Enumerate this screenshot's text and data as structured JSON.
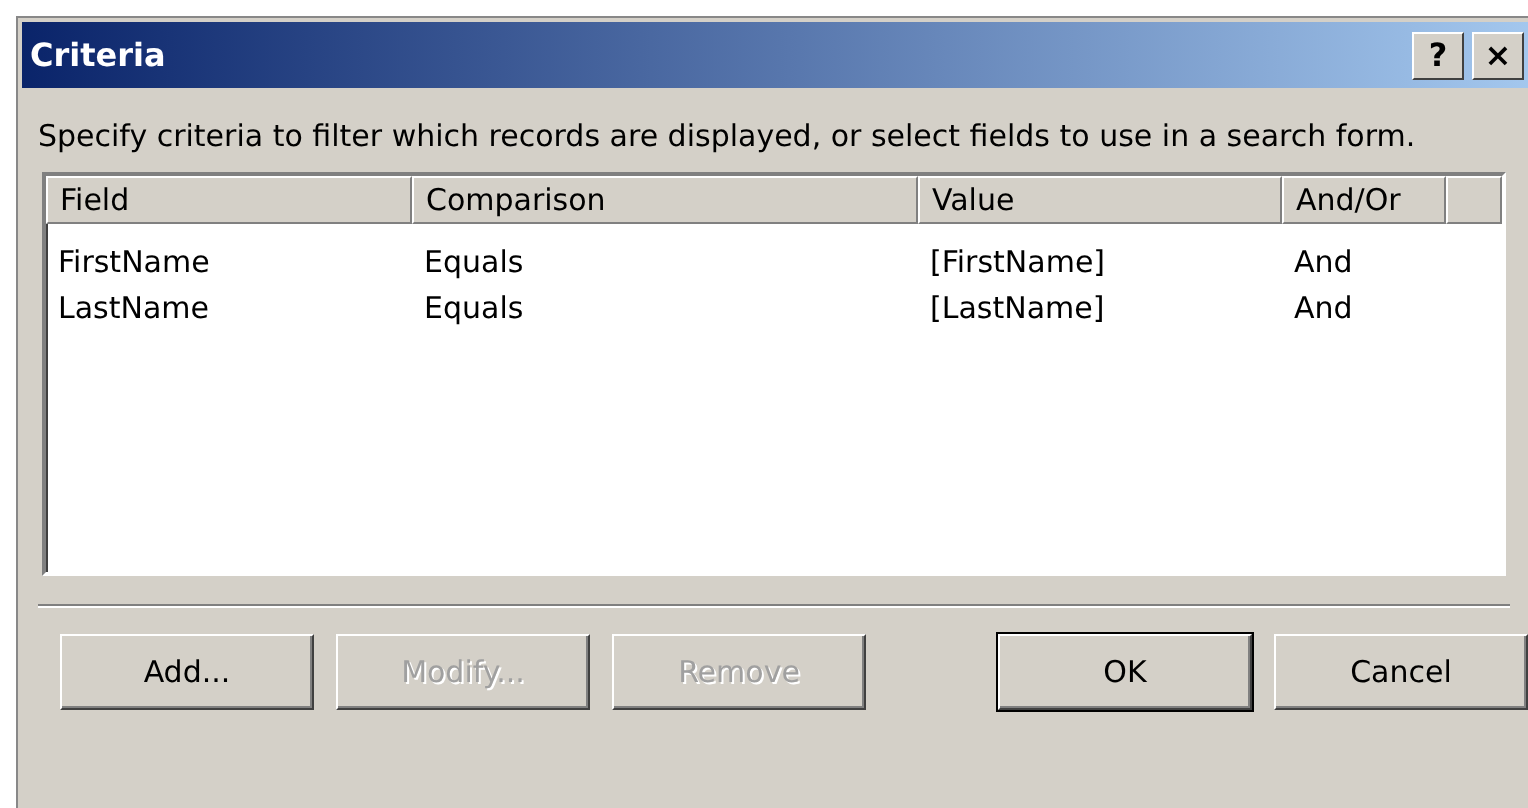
{
  "window": {
    "title": "Criteria",
    "controls": [
      "?",
      "×"
    ]
  },
  "instructions": "Specify criteria to filter which records are displayed, or select fields to use in a search form.",
  "table": {
    "columns": [
      "Field",
      "Comparison",
      "Value",
      "And/Or"
    ],
    "rows": [
      [
        "FirstName",
        "Equals",
        "[FirstName]",
        "And"
      ],
      [
        "LastName",
        "Equals",
        "[LastName]",
        "And"
      ]
    ]
  },
  "buttons": [
    {
      "label": "Add...",
      "disabled": false,
      "default": false
    },
    {
      "label": "Modify...",
      "disabled": true,
      "default": false
    },
    {
      "label": "Remove",
      "disabled": true,
      "default": false
    },
    {
      "label": "OK",
      "disabled": false,
      "default": true
    },
    {
      "label": "Cancel",
      "disabled": false,
      "default": false
    }
  ]
}
